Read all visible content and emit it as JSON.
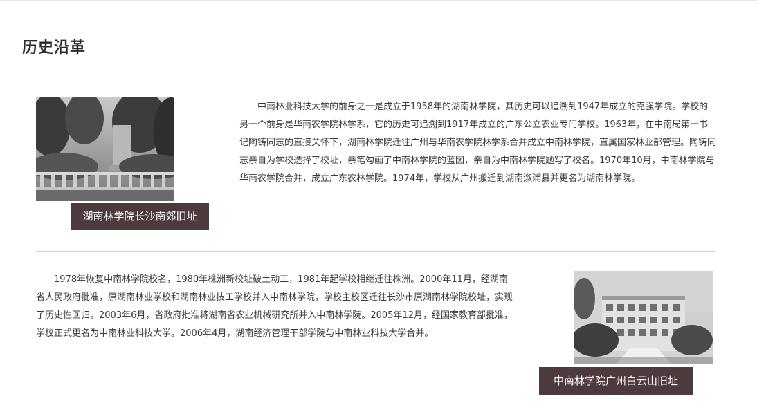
{
  "page": {
    "title": "历史沿革"
  },
  "section_1": {
    "photo_caption": "湖南林学院长沙南郊旧址",
    "paragraph": "中南林业科技大学的前身之一是成立于1958年的湖南林学院，其历史可以追溯到1947年成立的克强学院。学校的另一个前身是华南农学院林学系，它的历史可追溯到1917年成立的广东公立农业专门学校。1963年，在中南局第一书记陶铸同志的直接关怀下，湖南林学院迁往广州与华南农学院林学系合并成立中南林学院，直属国家林业部管理。陶铸同志亲自为学校选择了校址，亲笔勾画了中南林学院的蓝图，亲自为中南林学院题写了校名。1970年10月，中南林学院与华南农学院合并，成立广东农林学院。1974年，学校从广州搬迁到湖南溆浦县并更名为湖南林学院。"
  },
  "section_2": {
    "photo_caption": "中南林学院广州白云山旧址",
    "paragraph": "1978年恢复中南林学院校名，1980年株洲新校址破土动工，1981年起学校相继迁往株洲。2000年11月，经湖南省人民政府批准，原湖南林业学校和湖南林业技工学校并入中南林学院，学校主校区迁往长沙市原湖南林学院校址，实现了历史性回归。2003年6月，省政府批准将湖南省农业机械研究所并入中南林学院。2005年12月，经国家教育部批准，学校正式更名为中南林业科技大学。2006年4月，湖南经济管理干部学院与中南林业科技大学合并。"
  },
  "colors": {
    "caption_background": "#4d3a3d",
    "caption_text": "#ffffff",
    "title_text": "#2b2b2b",
    "body_text": "#3a3a3a"
  },
  "icons": {
    "photo_1": "old-campus-garden-photo",
    "photo_2": "old-campus-building-photo"
  }
}
